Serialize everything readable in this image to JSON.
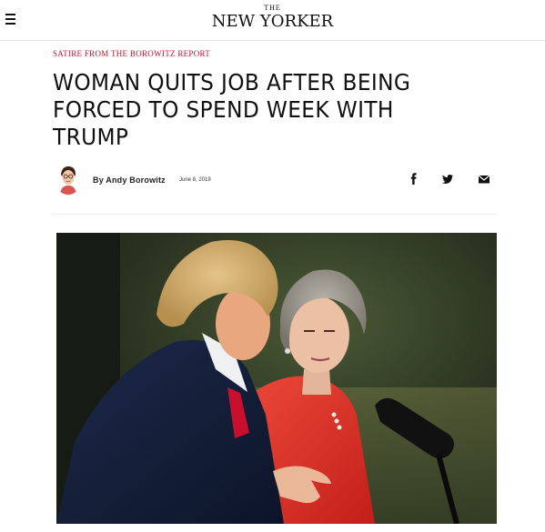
{
  "header": {
    "logo_the": "THE",
    "logo_name": "NEW YORKER"
  },
  "article": {
    "rubric": "Satire from the Borowitz Report",
    "headline": "WOMAN QUITS JOB AFTER BEING FORCED TO SPEND WEEK WITH TRUMP",
    "byline_prefix": "By",
    "author": "Andy Borowitz",
    "date": "June 8, 2019"
  },
  "share": {
    "facebook_glyph": "f",
    "icons": [
      "facebook-icon",
      "twitter-icon",
      "email-icon"
    ]
  },
  "colors": {
    "rubric": "#c8102e",
    "text": "#111111",
    "photo_background": "#1b2416"
  }
}
